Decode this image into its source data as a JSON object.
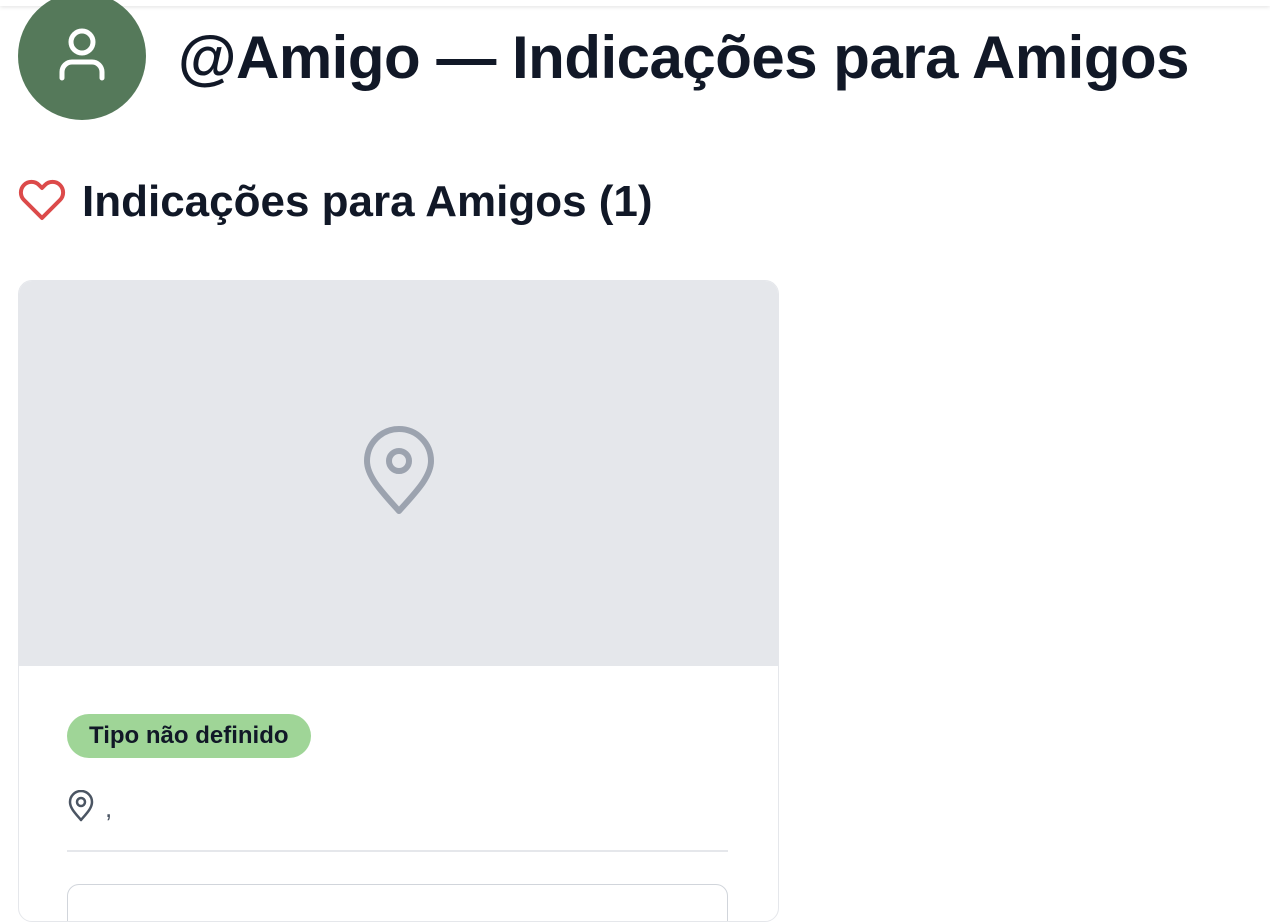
{
  "header": {
    "title": "@Amigo — Indicações para Amigos",
    "avatar_icon": "user-icon",
    "avatar_color": "#55795a"
  },
  "section": {
    "title": "Indicações para Amigos (1)",
    "icon": "heart-icon",
    "icon_color": "#dc4a4a"
  },
  "cards": [
    {
      "image_icon": "map-pin-icon",
      "type_badge": "Tipo não definido",
      "badge_color": "#9fd597",
      "location": ","
    }
  ]
}
